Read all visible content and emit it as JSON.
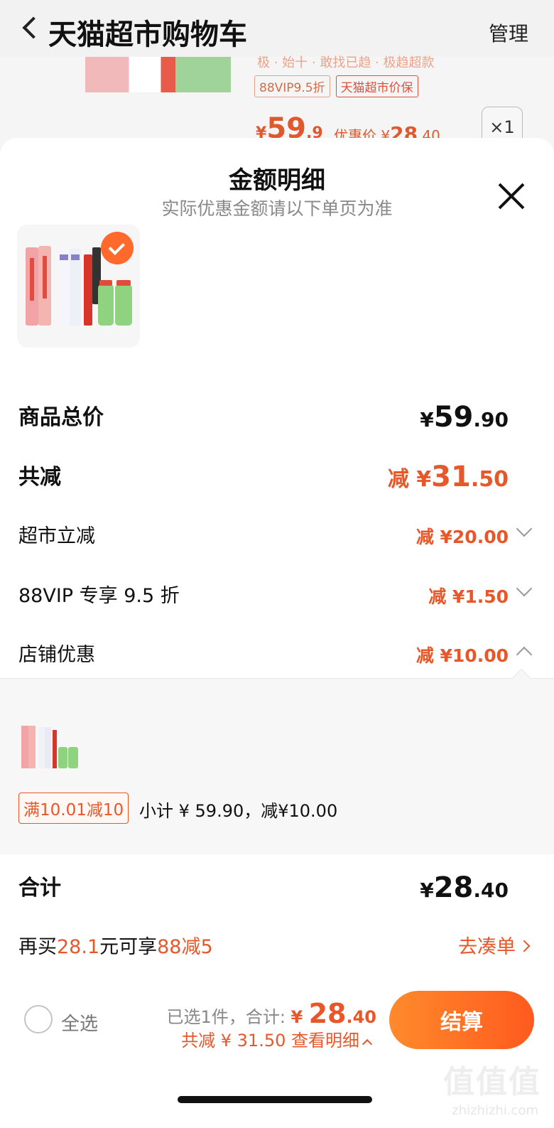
{
  "header": {
    "title": "天猫超市购物车",
    "manage": "管理"
  },
  "bg_item": {
    "cut_text": "极 · 始十 · 敢找已趋 · 极趋超款",
    "tags": [
      "88VIP9.5折",
      "天猫超市价保"
    ],
    "price_symbol": "¥",
    "price_int": "59",
    "price_dec": ".9",
    "after_label": "优惠价 ¥",
    "after_int": "28",
    "after_dec": ".40",
    "qty": "×1"
  },
  "panel": {
    "title": "金额明细",
    "subtitle": "实际优惠金额请以下单页为准",
    "rows": {
      "total": {
        "label": "商品总价",
        "sym": "¥",
        "int": "59",
        "dec": ".90"
      },
      "reduce": {
        "label": "共减",
        "prefix": "减 ¥",
        "int": "31",
        "dec": ".50"
      },
      "market": {
        "label": "超市立减",
        "value": "减 ¥20.00"
      },
      "vip": {
        "label": "88VIP 专享 9.5 折",
        "value": "减 ¥1.50"
      },
      "shop": {
        "label": "店铺优惠",
        "value": "减 ¥10.00"
      }
    },
    "shop_detail": {
      "tag": "满10.01减10",
      "subtotal": "小计 ¥ 59.90，减¥10.00"
    },
    "sum": {
      "label": "合计",
      "sym": "¥",
      "int": "28",
      "dec": ".40"
    }
  },
  "promo": {
    "pre": "再买",
    "amount": "28.1",
    "mid": "元可享",
    "offer": "88减5",
    "link": "去凑单"
  },
  "footer": {
    "select_all": "全选",
    "selected": "已选1件，合计: ",
    "sym": "¥ ",
    "int": "28",
    "dec": ".40",
    "saved": "共减 ¥ 31.50  查看明细",
    "checkout": "结算"
  },
  "watermark": {
    "main": "值值值",
    "sub": "zhizhizhi.com"
  },
  "colors": {
    "accent": "#e8572a",
    "checkout_start": "#ff8a2b",
    "checkout_end": "#ff5a1e"
  }
}
